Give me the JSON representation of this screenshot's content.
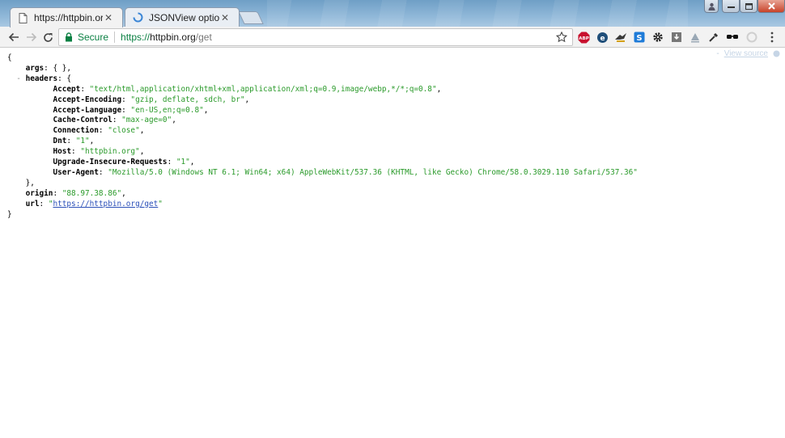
{
  "window": {
    "tabs": [
      {
        "title": "https://httpbin.org/get",
        "active": true
      },
      {
        "title": "JSONView options",
        "active": false
      }
    ]
  },
  "toolbar": {
    "secure_label": "Secure",
    "url_scheme": "https://",
    "url_host": "httpbin.org",
    "url_path": "/get",
    "extensions": [
      "abp-icon",
      "extension-e-icon",
      "extension-bird-icon",
      "extension-s-icon",
      "gear-icon",
      "extension-download-icon",
      "extension-triangle-icon",
      "eyedropper-icon",
      "glasses-icon",
      "extension-cloud-icon"
    ]
  },
  "viewer": {
    "collapse_marker": "-",
    "view_source_label": "View source"
  },
  "json": {
    "open_brace": "{",
    "close_brace": "}",
    "args_key": "args",
    "args_value": "{ }",
    "headers_key": "headers",
    "headers_open": "{",
    "headers_close": "},",
    "headers": [
      {
        "key": "Accept",
        "value": "\"text/html,application/xhtml+xml,application/xml;q=0.9,image/webp,*/*;q=0.8\""
      },
      {
        "key": "Accept-Encoding",
        "value": "\"gzip, deflate, sdch, br\""
      },
      {
        "key": "Accept-Language",
        "value": "\"en-US,en;q=0.8\""
      },
      {
        "key": "Cache-Control",
        "value": "\"max-age=0\""
      },
      {
        "key": "Connection",
        "value": "\"close\""
      },
      {
        "key": "Dnt",
        "value": "\"1\""
      },
      {
        "key": "Host",
        "value": "\"httpbin.org\""
      },
      {
        "key": "Upgrade-Insecure-Requests",
        "value": "\"1\""
      },
      {
        "key": "User-Agent",
        "value": "\"Mozilla/5.0 (Windows NT 6.1; Win64; x64) AppleWebKit/537.36 (KHTML, like Gecko) Chrome/58.0.3029.110 Safari/537.36\""
      }
    ],
    "origin_key": "origin",
    "origin_value": "\"88.97.38.86\"",
    "url_key": "url",
    "url_value": "https://httpbin.org/get"
  },
  "colors": {
    "string": "#2a9a2a",
    "link": "#2a4fb8",
    "secure": "#0b8043"
  }
}
